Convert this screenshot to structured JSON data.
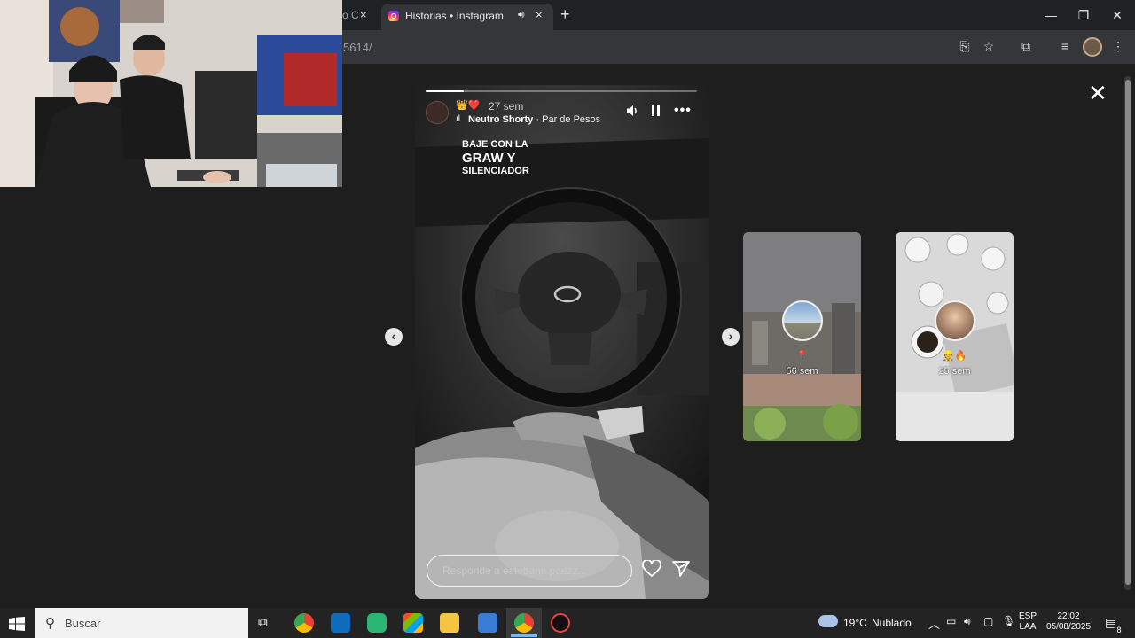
{
  "browser": {
    "prev_tab": {
      "title_fragment": "o C",
      "close": "×"
    },
    "active_tab": {
      "title": "Historias • Instagram",
      "audio_icon": "speaker-icon",
      "close": "×"
    },
    "new_tab": "+",
    "window_controls": {
      "minimize": "—",
      "maximize": "❐",
      "close": "✕"
    },
    "url_fragment": "5614/"
  },
  "story": {
    "progress_fraction": 0.14,
    "header_emojis": "👑❤️",
    "time_ago": "27 sem",
    "music": {
      "icon": "audio-bars-icon",
      "artist": "Neutro Shorty",
      "separator": " · ",
      "song": "Par de Pesos"
    },
    "caption": {
      "line1": "BAJE CON LA",
      "line2": "GRAW Y",
      "line3": "SILENCIADOR"
    },
    "reply_placeholder": "Responde a estebann.paezz...",
    "controls": [
      "volume-icon",
      "pause-icon",
      "more-icon"
    ]
  },
  "previews": [
    {
      "emoji": "📍",
      "time": "56 sem"
    },
    {
      "emoji": "👷🔥",
      "time": "25 sem"
    }
  ],
  "taskbar": {
    "search_placeholder": "Buscar",
    "weather": {
      "temp": "19°C",
      "condition": "Nublado"
    },
    "lang": {
      "line1": "ESP",
      "line2": "LAA"
    },
    "clock": {
      "time": "22:02",
      "date": "05/08/2025"
    },
    "notification_count": "8"
  }
}
